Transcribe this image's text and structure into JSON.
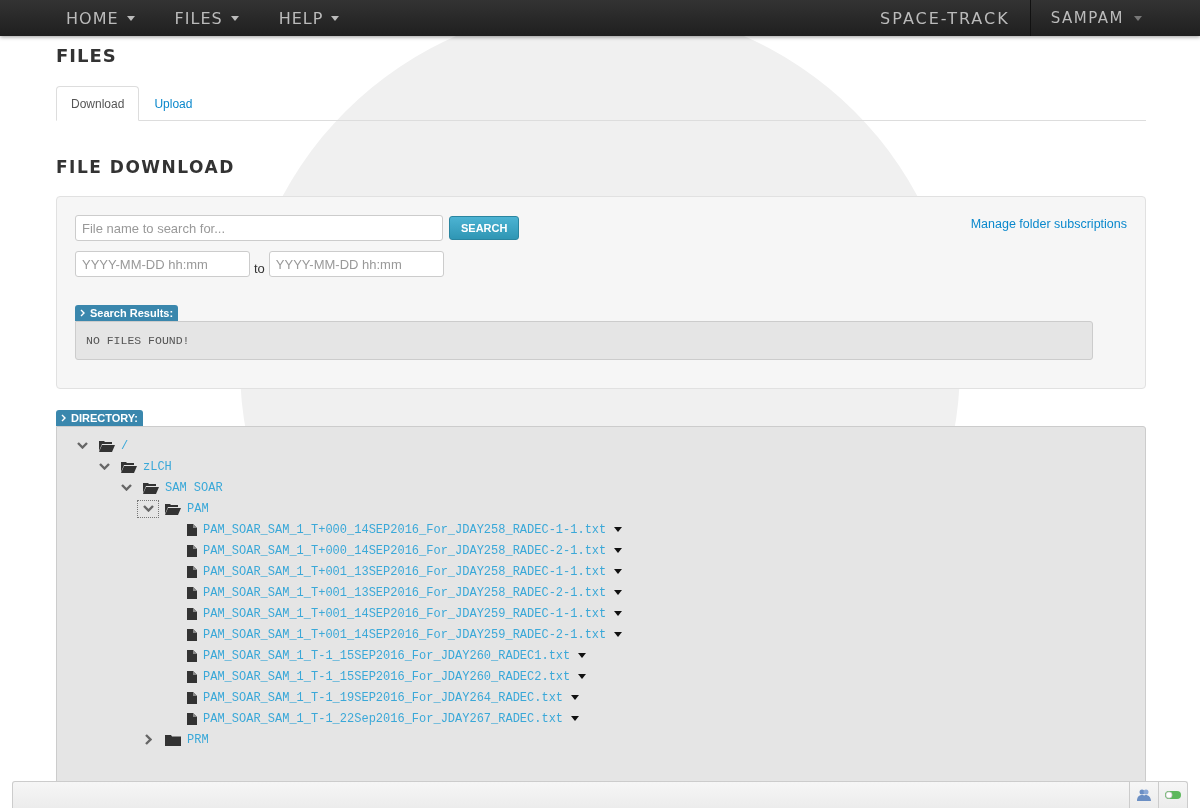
{
  "navbar": {
    "menus": [
      {
        "label": "HOME"
      },
      {
        "label": "FILES"
      },
      {
        "label": "HELP"
      }
    ],
    "brand": "SPACE-TRACK",
    "user": "SAMPAM"
  },
  "page_title": "FILES",
  "tabs": [
    {
      "label": "Download",
      "selected": true
    },
    {
      "label": "Upload",
      "selected": false
    }
  ],
  "section_title": "FILE DOWNLOAD",
  "search": {
    "placeholder": "File name to search for...",
    "button": "SEARCH",
    "date_from_placeholder": "YYYY-MM-DD hh:mm",
    "to_label": "to",
    "date_to_placeholder": "YYYY-MM-DD hh:mm",
    "manage_link": "Manage folder subscriptions"
  },
  "results": {
    "label": "Search Results:",
    "message": "NO FILES FOUND!"
  },
  "directory": {
    "label": "DIRECTORY:",
    "tree": [
      {
        "kind": "folder",
        "name": "/",
        "expanded": true,
        "focused": false,
        "children": [
          {
            "kind": "folder",
            "name": "zLCH",
            "expanded": true,
            "focused": false,
            "children": [
              {
                "kind": "folder",
                "name": "SAM SOAR",
                "expanded": true,
                "focused": false,
                "children": [
                  {
                    "kind": "folder",
                    "name": "PAM",
                    "expanded": true,
                    "focused": true,
                    "children": [
                      {
                        "kind": "file",
                        "name": "PAM_SOAR_SAM_1_T+000_14SEP2016_For_JDAY258_RADEC-1-1.txt"
                      },
                      {
                        "kind": "file",
                        "name": "PAM_SOAR_SAM_1_T+000_14SEP2016_For_JDAY258_RADEC-2-1.txt"
                      },
                      {
                        "kind": "file",
                        "name": "PAM_SOAR_SAM_1_T+001_13SEP2016_For_JDAY258_RADEC-1-1.txt"
                      },
                      {
                        "kind": "file",
                        "name": "PAM_SOAR_SAM_1_T+001_13SEP2016_For_JDAY258_RADEC-2-1.txt"
                      },
                      {
                        "kind": "file",
                        "name": "PAM_SOAR_SAM_1_T+001_14SEP2016_For_JDAY259_RADEC-1-1.txt"
                      },
                      {
                        "kind": "file",
                        "name": "PAM_SOAR_SAM_1_T+001_14SEP2016_For_JDAY259_RADEC-2-1.txt"
                      },
                      {
                        "kind": "file",
                        "name": "PAM_SOAR_SAM_1_T-1_15SEP2016_For_JDAY260_RADEC1.txt"
                      },
                      {
                        "kind": "file",
                        "name": "PAM_SOAR_SAM_1_T-1_15SEP2016_For_JDAY260_RADEC2.txt"
                      },
                      {
                        "kind": "file",
                        "name": "PAM_SOAR_SAM_1_T-1_19SEP2016_For_JDAY264_RADEC.txt"
                      },
                      {
                        "kind": "file",
                        "name": "PAM_SOAR_SAM_1_T-1_22Sep2016_For_JDAY267_RADEC.txt"
                      }
                    ]
                  },
                  {
                    "kind": "folder",
                    "name": "PRM",
                    "expanded": false,
                    "focused": false
                  }
                ]
              }
            ]
          }
        ]
      }
    ]
  }
}
